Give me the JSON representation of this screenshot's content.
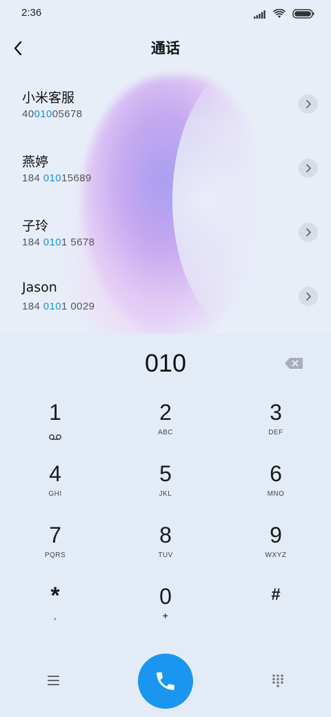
{
  "status_bar": {
    "time": "2:36",
    "icons": [
      "signal-icon",
      "wifi-icon",
      "battery-icon"
    ]
  },
  "header": {
    "title": "通话",
    "back_icon": "chevron-left-icon"
  },
  "contacts": [
    {
      "name": "小米客服",
      "number_parts": [
        {
          "text": "40",
          "highlight": false
        },
        {
          "text": "010",
          "highlight": true
        },
        {
          "text": "05678",
          "highlight": false
        }
      ]
    },
    {
      "name": "燕婷",
      "number_parts": [
        {
          "text": "184 ",
          "highlight": false
        },
        {
          "text": "010",
          "highlight": true
        },
        {
          "text": "15689",
          "highlight": false
        }
      ]
    },
    {
      "name": "子玲",
      "number_parts": [
        {
          "text": "184 ",
          "highlight": false
        },
        {
          "text": "010",
          "highlight": true
        },
        {
          "text": "1 5678",
          "highlight": false
        }
      ]
    },
    {
      "name": "Jason",
      "number_parts": [
        {
          "text": "184 ",
          "highlight": false
        },
        {
          "text": "010",
          "highlight": true
        },
        {
          "text": "1 0029",
          "highlight": false
        }
      ]
    }
  ],
  "dialer": {
    "input_value": "010",
    "keys": [
      {
        "digit": "1",
        "sub": "",
        "sub_icon": "voicemail-icon"
      },
      {
        "digit": "2",
        "sub": "ABC"
      },
      {
        "digit": "3",
        "sub": "DEF"
      },
      {
        "digit": "4",
        "sub": "GHI"
      },
      {
        "digit": "5",
        "sub": "JKL"
      },
      {
        "digit": "6",
        "sub": "MNO"
      },
      {
        "digit": "7",
        "sub": "PQRS"
      },
      {
        "digit": "8",
        "sub": "TUV"
      },
      {
        "digit": "9",
        "sub": "WXYZ"
      },
      {
        "digit": "*",
        "sub": ","
      },
      {
        "digit": "0",
        "sub": "+"
      },
      {
        "digit": "#",
        "sub": ""
      }
    ]
  },
  "colors": {
    "accent": "#1a96f0",
    "highlight": "#1a93e0",
    "background": "#e3ebf6"
  }
}
